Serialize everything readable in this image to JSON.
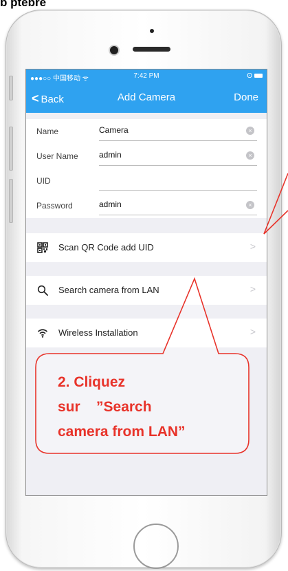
{
  "doc_title": "b ptebre",
  "status_bar": {
    "left": "●●●○○ 中国移动 ᯤ",
    "time": "7:42 PM"
  },
  "nav": {
    "back": "Back",
    "title": "Add Camera",
    "done": "Done"
  },
  "form": {
    "rows": [
      {
        "label": "Name",
        "value": "Camera"
      },
      {
        "label": "User Name",
        "value": "admin"
      },
      {
        "label": "UID",
        "value": ""
      },
      {
        "label": "Password",
        "value": "admin"
      }
    ]
  },
  "menu": [
    {
      "icon": "qr-code-icon",
      "label": "Scan QR Code add UID"
    },
    {
      "icon": "search-icon",
      "label": "Search camera from LAN"
    },
    {
      "icon": "wifi-icon",
      "label": "Wireless Installation"
    }
  ],
  "callout": {
    "line1": "2. Cliquez",
    "line2": "sur    ”Search",
    "line3": "camera from LAN”"
  },
  "colors": {
    "nav": "#2fa2f0",
    "callout": "#e8332a",
    "screen_bg": "#efeff4"
  }
}
